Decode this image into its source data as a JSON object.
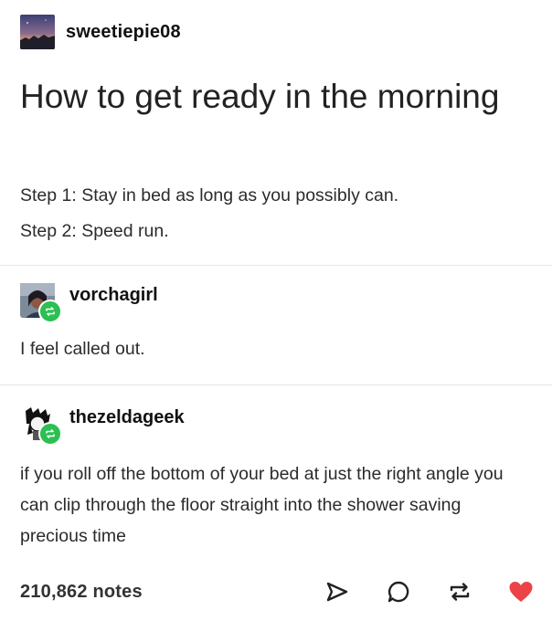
{
  "post": {
    "author": "sweetiepie08",
    "title": "How to get ready in the morning",
    "steps": [
      "Step 1: Stay in bed as long as you possibly can.",
      "Step 2: Speed run."
    ]
  },
  "reblogs": [
    {
      "username": "vorchagirl",
      "text": "I feel called out."
    },
    {
      "username": "thezeldageek",
      "text": "if you roll off the bottom of your bed at just the right angle you can clip through the floor straight into the shower saving precious time"
    }
  ],
  "footer": {
    "notes": "210,862 notes"
  },
  "icons": {
    "share": "share-icon",
    "reply": "reply-icon",
    "reblog": "reblog-icon",
    "like": "heart-icon"
  },
  "colors": {
    "reblog_green": "#2cbf52",
    "like_red": "#ec4346"
  }
}
